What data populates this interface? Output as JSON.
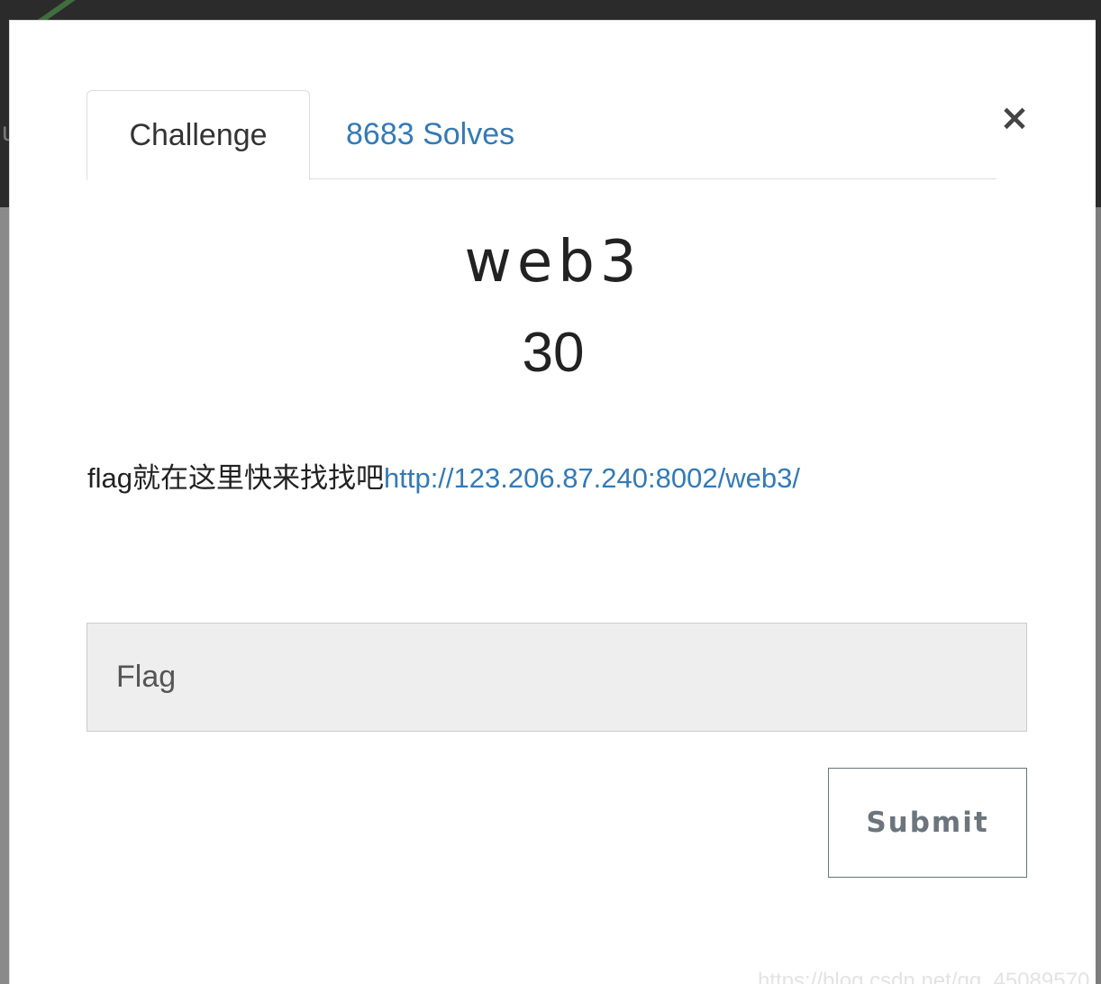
{
  "backdrop": {
    "glyph": "u"
  },
  "modal": {
    "close_symbol": "×",
    "tabs": [
      {
        "label": "Challenge",
        "active": true
      },
      {
        "label": "8683 Solves",
        "active": false
      }
    ],
    "challenge": {
      "name": "web3",
      "value": "30",
      "description_text": "flag就在这里快来找找吧",
      "description_link": "http://123.206.87.240:8002/web3/"
    },
    "flag_input": {
      "placeholder": "Flag",
      "value": ""
    },
    "submit_label": "Submit"
  },
  "watermark": "https://blog.csdn.net/qq_45089570",
  "colors": {
    "link": "#337ab7",
    "submit_border": "#6c757d",
    "input_bg": "#eeeeee"
  },
  "icons": {
    "close": "close-icon"
  }
}
